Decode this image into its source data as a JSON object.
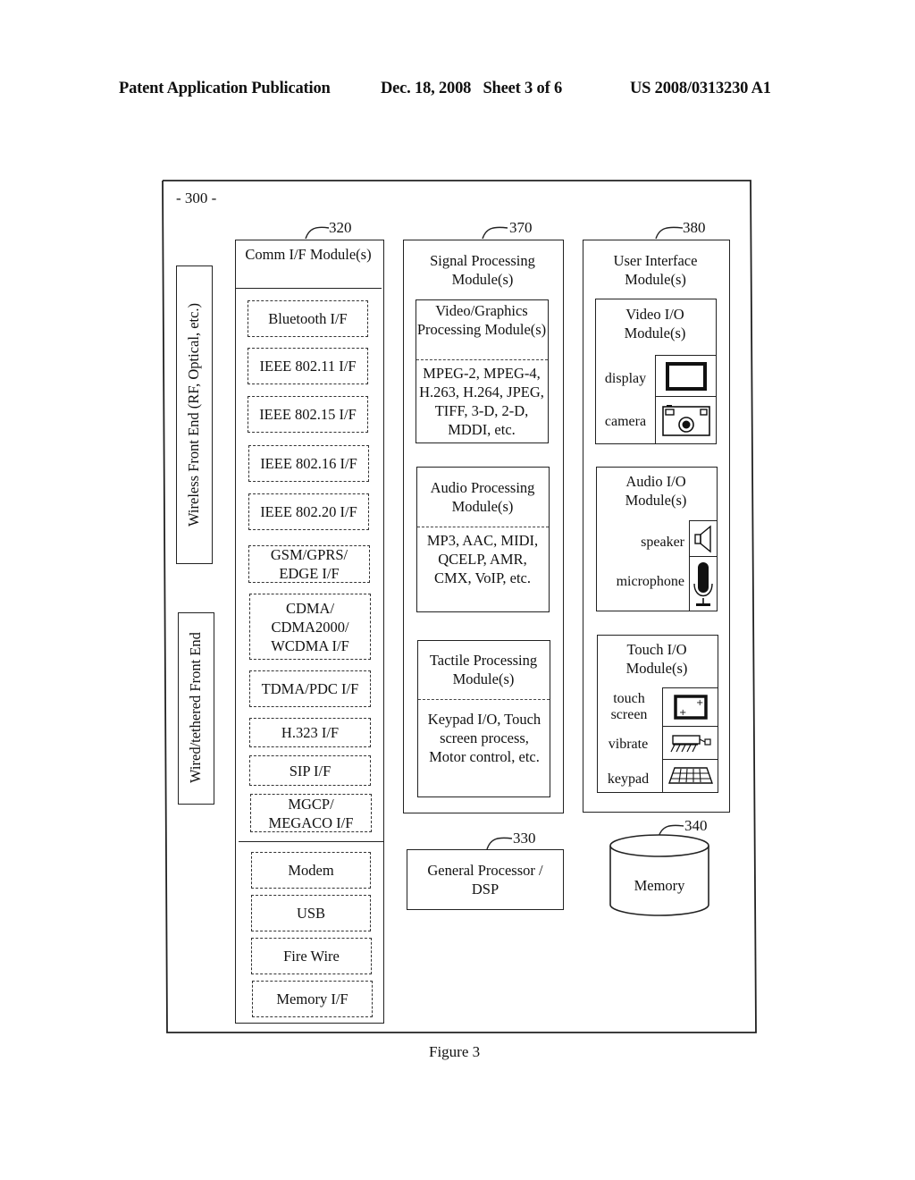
{
  "header": {
    "publication": "Patent Application Publication",
    "date_sheet": "Dec. 18, 2008   Sheet 3 of 6",
    "patent_number": "US 2008/0313230 A1"
  },
  "figure": {
    "ref": "- 300 -",
    "caption": "Figure 3",
    "front_ends": {
      "wireless": "Wireless Front End (RF, Optical, etc.)",
      "wired": "Wired/tethered Front End"
    },
    "comm_module": {
      "ref": "320",
      "title": "Comm I/F Module(s)",
      "wireless_interfaces": [
        "Bluetooth I/F",
        "IEEE 802.11 I/F",
        "IEEE 802.15 I/F",
        "IEEE 802.16 I/F",
        "IEEE 802.20 I/F",
        "GSM/GPRS/ EDGE I/F",
        "CDMA/ CDMA2000/ WCDMA I/F",
        "TDMA/PDC I/F",
        "H.323 I/F",
        "SIP I/F",
        "MGCP/ MEGACO I/F"
      ],
      "wired_interfaces": [
        "Modem",
        "USB",
        "Fire Wire",
        "Memory I/F"
      ]
    },
    "signal_processing": {
      "ref": "370",
      "title": "Signal Processing Module(s)",
      "video": {
        "title": "Video/Graphics Processing Module(s)",
        "formats": "MPEG-2, MPEG-4, H.263, H.264, JPEG, TIFF, 3-D, 2-D, MDDI, etc."
      },
      "audio": {
        "title": "Audio Processing Module(s)",
        "formats": "MP3, AAC, MIDI, QCELP, AMR, CMX, VoIP, etc."
      },
      "tactile": {
        "title": "Tactile Processing Module(s)",
        "formats": "Keypad I/O, Touch screen process, Motor control, etc."
      }
    },
    "user_interface": {
      "ref": "380",
      "title": "User Interface Module(s)",
      "video_io": {
        "title": "Video I/O Module(s)",
        "items": [
          {
            "label": "display",
            "icon": "display-icon"
          },
          {
            "label": "camera",
            "icon": "camera-icon"
          }
        ]
      },
      "audio_io": {
        "title": "Audio I/O Module(s)",
        "items": [
          {
            "label": "speaker",
            "icon": "speaker-icon"
          },
          {
            "label": "microphone",
            "icon": "microphone-icon"
          }
        ]
      },
      "touch_io": {
        "title": "Touch I/O Module(s)",
        "items": [
          {
            "label": "touch screen",
            "icon": "touch-screen-icon"
          },
          {
            "label": "vibrate",
            "icon": "vibrate-motor-icon"
          },
          {
            "label": "keypad",
            "icon": "keypad-icon"
          }
        ]
      }
    },
    "processor": {
      "ref": "330",
      "title": "General Processor / DSP"
    },
    "memory": {
      "ref": "340",
      "title": "Memory"
    }
  }
}
